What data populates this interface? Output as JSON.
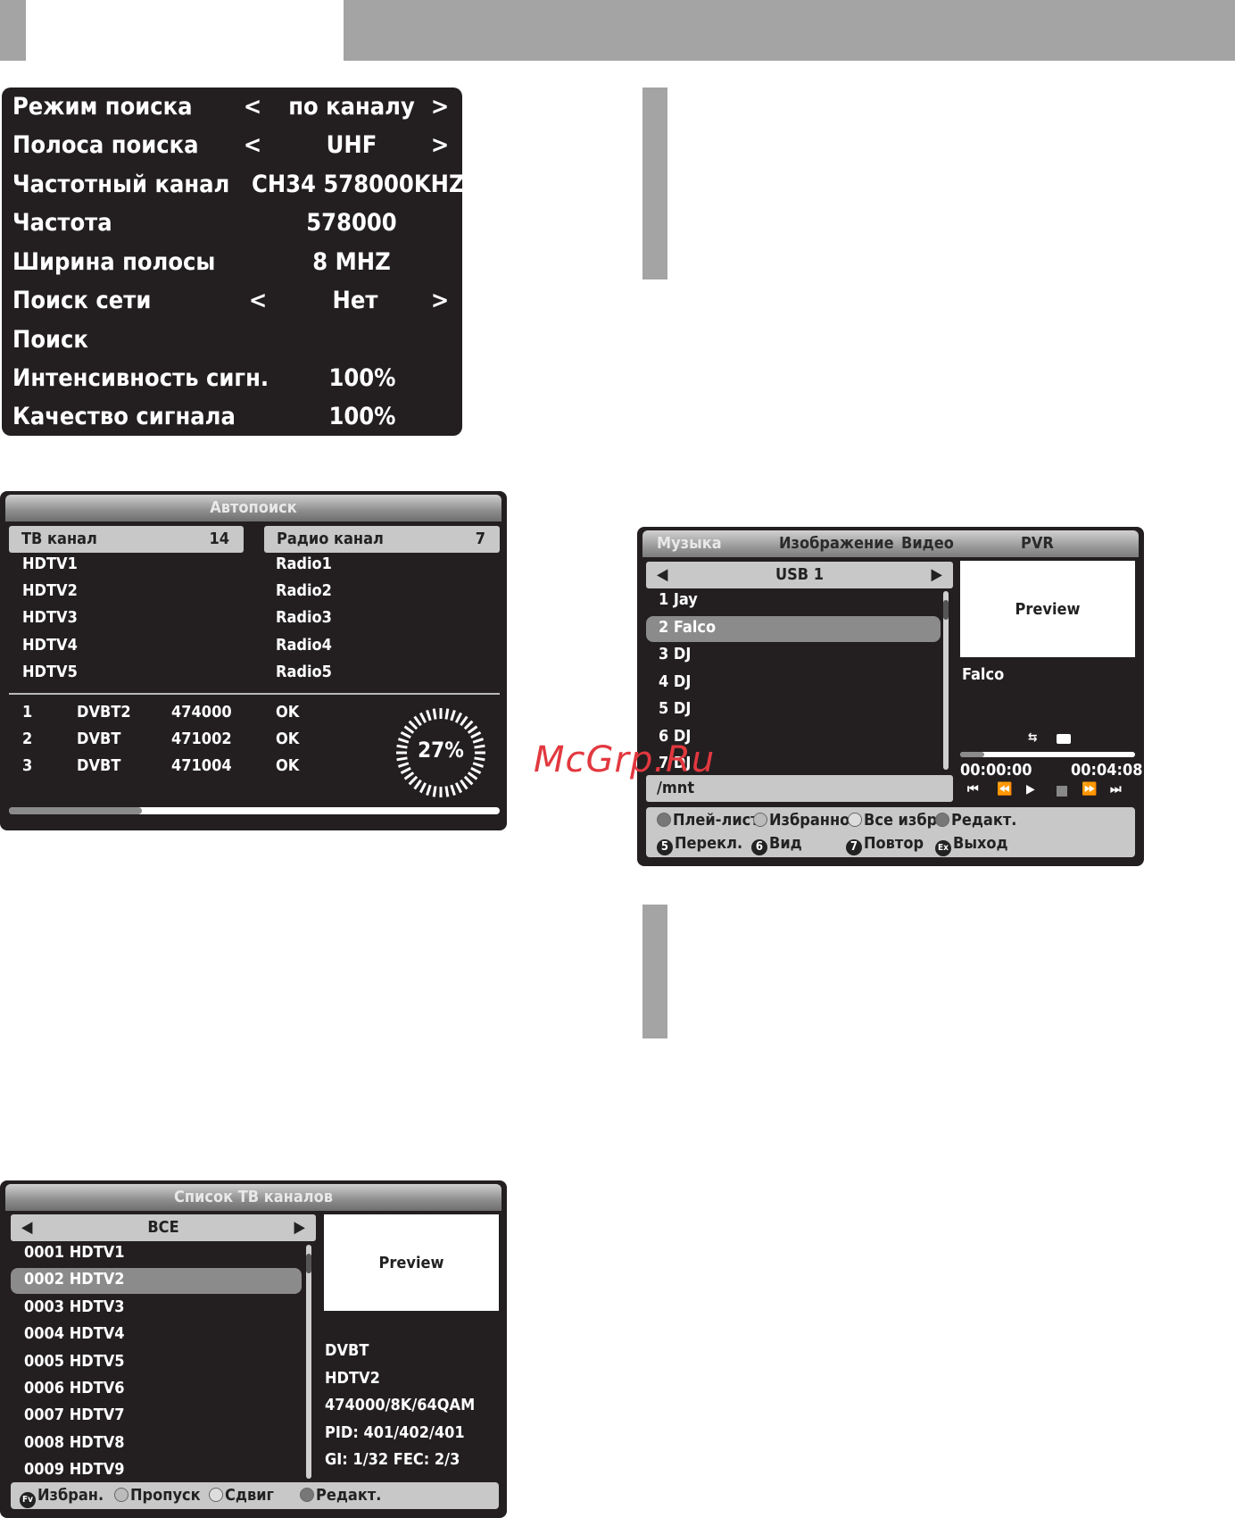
{
  "manual_search": {
    "rows": [
      {
        "label": "Режим поиска",
        "value": "по каналу",
        "left": "<",
        "right": ">"
      },
      {
        "label": "Полоса поиска",
        "value": "UHF",
        "left": "<",
        "right": ">"
      },
      {
        "label": "Частотный канал",
        "value": "CH34 578000KHZ",
        "left": "",
        "right": ""
      },
      {
        "label": "Частота",
        "value": "578000",
        "left": "",
        "right": ""
      },
      {
        "label": "Ширина полосы",
        "value": "8 MHZ",
        "left": "",
        "right": ""
      },
      {
        "label": "Поиск сети",
        "value": "Нет",
        "left": "<",
        "right": ">"
      },
      {
        "label": "Поиск",
        "value": "",
        "left": "",
        "right": ""
      },
      {
        "label": "Интенсивность сигн.",
        "value": "100%",
        "left": "",
        "right": ""
      },
      {
        "label": "Качество сигнала",
        "value": "100%",
        "left": "",
        "right": ""
      }
    ]
  },
  "autosearch": {
    "title": "Автопоиск",
    "tv_header": "ТВ канал",
    "tv_count": "14",
    "radio_header": "Радио канал",
    "radio_count": "7",
    "tv_channels": [
      "HDTV1",
      "HDTV2",
      "HDTV3",
      "HDTV4",
      "HDTV5"
    ],
    "radio_channels": [
      "Radio1",
      "Radio2",
      "Radio3",
      "Radio4",
      "Radio5"
    ],
    "scan_rows": [
      {
        "n": "1",
        "type": "DVBT2",
        "freq": "474000",
        "status": "OK"
      },
      {
        "n": "2",
        "type": "DVBT",
        "freq": "471002",
        "status": "OK"
      },
      {
        "n": "3",
        "type": "DVBT",
        "freq": "471004",
        "status": "OK"
      }
    ],
    "progress_text": "27%",
    "progress": 0.27
  },
  "music_player": {
    "tabs": [
      "Музыка",
      "Изображение",
      "Видео",
      "PVR"
    ],
    "source": "USB 1",
    "tracks": [
      "1 Jay",
      "2 Falco",
      "3 DJ",
      "4 DJ",
      "5 DJ",
      "6 DJ",
      "7 DJ"
    ],
    "selected_index": 1,
    "path": "/mnt",
    "preview_label": "Preview",
    "now_playing": "Falco",
    "time_current": "00:00:00",
    "time_total": "00:04:08",
    "playback_progress": 0.14,
    "footer_row1": [
      "Плей-лист",
      "Избранное",
      "Все избр.",
      "Редакт."
    ],
    "footer_row2": [
      {
        "key": "5",
        "label": "Перекл."
      },
      {
        "key": "6",
        "label": "Вид"
      },
      {
        "key": "7",
        "label": "Повтор"
      },
      {
        "key": "Ex",
        "label": "Выход"
      }
    ]
  },
  "channel_list": {
    "title": "Список ТВ каналов",
    "group": "ВСЕ",
    "channels": [
      "0001 HDTV1",
      "0002 HDTV2",
      "0003 HDTV3",
      "0004 HDTV4",
      "0005 HDTV5",
      "0006 HDTV6",
      "0007 HDTV7",
      "0008 HDTV8",
      "0009 HDTV9"
    ],
    "selected_index": 1,
    "preview_label": "Preview",
    "info": [
      "DVBT",
      "HDTV2",
      "474000/8K/64QAM",
      "PID: 401/402/401",
      "GI: 1/32 FEC: 2/3"
    ],
    "footer": [
      {
        "key": "Fv",
        "label": "Избран."
      },
      {
        "key": "",
        "label": "Пропуск"
      },
      {
        "key": "",
        "label": "Сдвиг"
      },
      {
        "key": "",
        "label": "Редакт."
      }
    ]
  },
  "watermark": "McGrp.Ru",
  "colors": {
    "panel": "#231f20",
    "bar_gray": "#a5a4a4",
    "highlight": "#8b8b8b",
    "watermark": "#e2383f"
  }
}
